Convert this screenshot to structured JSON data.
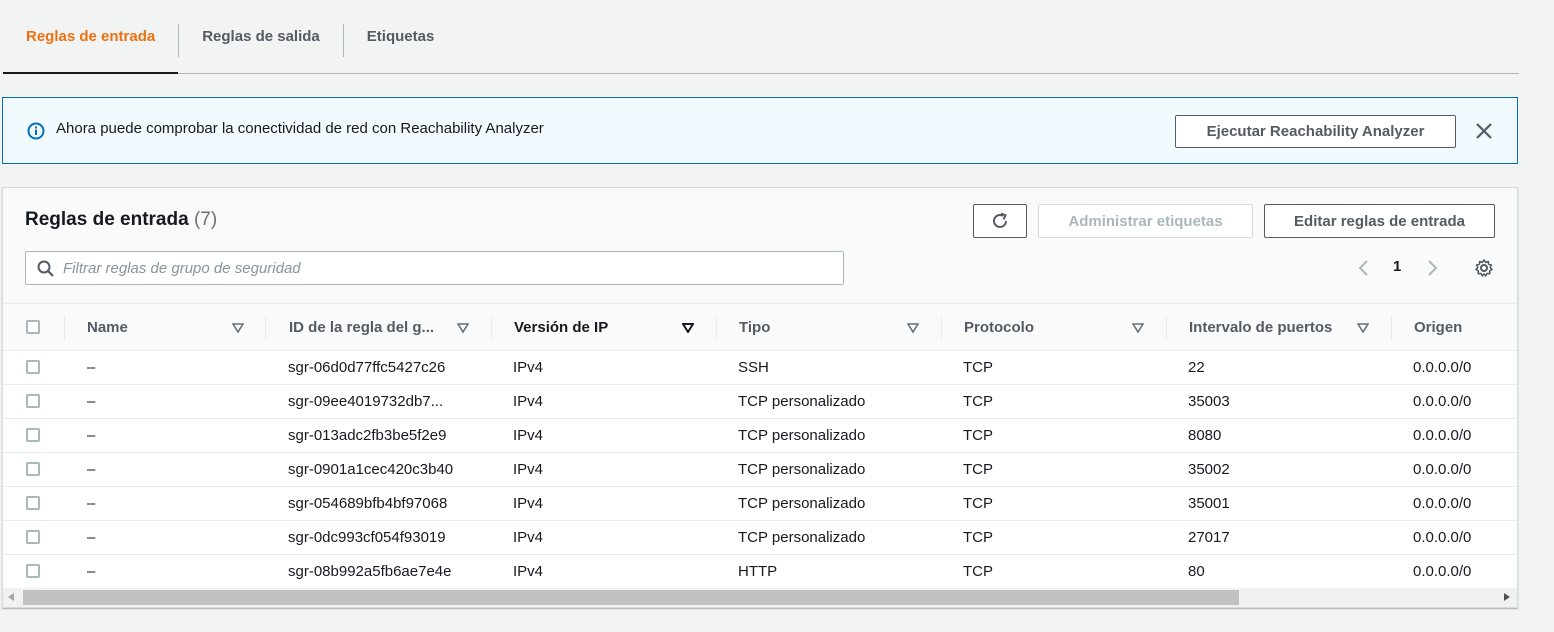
{
  "tabs": [
    {
      "label": "Reglas de entrada",
      "active": true
    },
    {
      "label": "Reglas de salida",
      "active": false
    },
    {
      "label": "Etiquetas",
      "active": false
    }
  ],
  "banner": {
    "text": "Ahora puede comprobar la conectividad de red con Reachability Analyzer",
    "button_label": "Ejecutar Reachability Analyzer"
  },
  "panel": {
    "title": "Reglas de entrada",
    "count": "(7)",
    "manage_tags_label": "Administrar etiquetas",
    "edit_rules_label": "Editar reglas de entrada",
    "search_placeholder": "Filtrar reglas de grupo de seguridad",
    "current_page": "1"
  },
  "table": {
    "columns": [
      "Name",
      "ID de la regla del g...",
      "Versión de IP",
      "Tipo",
      "Protocolo",
      "Intervalo de puertos",
      "Origen"
    ],
    "rows": [
      {
        "name": "–",
        "rule_id": "sgr-06d0d77ffc5427c26",
        "ip_version": "IPv4",
        "type": "SSH",
        "protocol": "TCP",
        "port_range": "22",
        "source": "0.0.0.0/0"
      },
      {
        "name": "–",
        "rule_id": "sgr-09ee4019732db7...",
        "ip_version": "IPv4",
        "type": "TCP personalizado",
        "protocol": "TCP",
        "port_range": "35003",
        "source": "0.0.0.0/0"
      },
      {
        "name": "–",
        "rule_id": "sgr-013adc2fb3be5f2e9",
        "ip_version": "IPv4",
        "type": "TCP personalizado",
        "protocol": "TCP",
        "port_range": "8080",
        "source": "0.0.0.0/0"
      },
      {
        "name": "–",
        "rule_id": "sgr-0901a1cec420c3b40",
        "ip_version": "IPv4",
        "type": "TCP personalizado",
        "protocol": "TCP",
        "port_range": "35002",
        "source": "0.0.0.0/0"
      },
      {
        "name": "–",
        "rule_id": "sgr-054689bfb4bf97068",
        "ip_version": "IPv4",
        "type": "TCP personalizado",
        "protocol": "TCP",
        "port_range": "35001",
        "source": "0.0.0.0/0"
      },
      {
        "name": "–",
        "rule_id": "sgr-0dc993cf054f93019",
        "ip_version": "IPv4",
        "type": "TCP personalizado",
        "protocol": "TCP",
        "port_range": "27017",
        "source": "0.0.0.0/0"
      },
      {
        "name": "–",
        "rule_id": "sgr-08b992a5fb6ae7e4e",
        "ip_version": "IPv4",
        "type": "HTTP",
        "protocol": "TCP",
        "port_range": "80",
        "source": "0.0.0.0/0"
      }
    ]
  },
  "colors": {
    "active_tab": "#ec7211",
    "info_blue": "#0073bb",
    "banner_bg": "#f1faff"
  }
}
